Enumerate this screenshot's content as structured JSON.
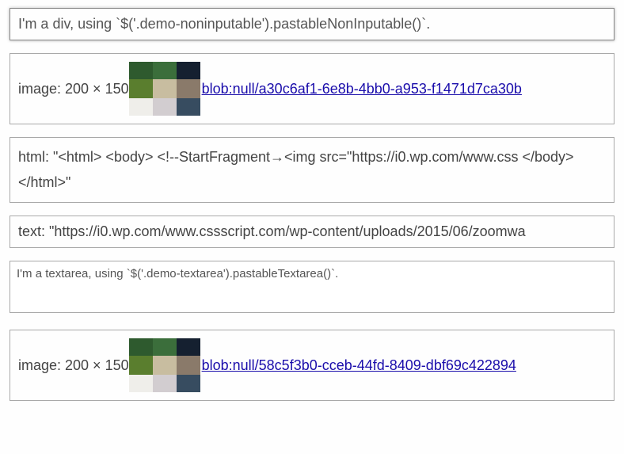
{
  "div_input": {
    "text": "I'm a div, using `$('.demo-noninputable').pastableNonInputable()`."
  },
  "results1": {
    "image": {
      "label": "image: 200 × 150",
      "blob_url": "blob:null/a30c6af1-6e8b-4bb0-a953-f1471d7ca30b"
    },
    "html": {
      "text": "html: \"<html> <body> <!--StartFragment→<img src=\"https://i0.wp.com/www.css </body> </html>\""
    },
    "text_out": {
      "text": "text: \"https://i0.wp.com/www.cssscript.com/wp-content/uploads/2015/06/zoomwa"
    }
  },
  "textarea_input": {
    "value": "",
    "placeholder_text": "I'm a textarea, using `$('.demo-textarea').pastableTextarea()`."
  },
  "results2": {
    "image": {
      "label": "image: 200 × 150",
      "blob_url": "blob:null/58c5f3b0-cceb-44fd-8409-dbf69c422894"
    }
  }
}
